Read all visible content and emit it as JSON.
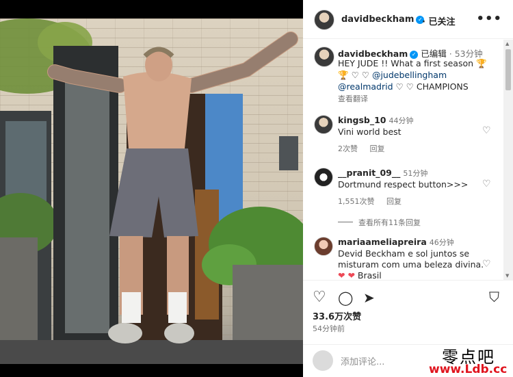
{
  "photo": {
    "alt": ""
  },
  "header": {
    "username": "davidbeckham",
    "follow_status": "已关注",
    "more": "•••"
  },
  "caption": {
    "username": "davidbeckham",
    "edited": "已编辑",
    "time": "53分钟",
    "line1": "HEY JUDE !! What a first season",
    "mention1": "@judebellingham",
    "mention2": "@realmadrid",
    "champions": "CHAMPIONS",
    "translate": "查看翻译"
  },
  "comments": [
    {
      "username": "kingsb_10",
      "time": "44分钟",
      "text": "Vini world best",
      "likes": "2次赞",
      "reply": "回复"
    },
    {
      "username": "__pranit_09__",
      "time": "51分钟",
      "text": "Dortmund respect button>>>",
      "likes": "1,551次赞",
      "reply": "回复",
      "view_replies": "查看所有11条回复"
    },
    {
      "username": "mariaameliapreira",
      "time": "46分钟",
      "text_line1": "Devid Beckham e sol juntos se",
      "text_line2": "misturam com uma beleza divina.",
      "text_line3": "Brasil"
    }
  ],
  "actions": {
    "likes": "33.6万次赞",
    "posted": "54分钟前"
  },
  "add_comment": {
    "placeholder": "添加评论..."
  },
  "watermark": {
    "line1": "零点吧",
    "line2": "www.Ldb.cc"
  },
  "colors": {
    "verified": "#0095f6",
    "heart": "#ed4956",
    "watermark": "#e0141e"
  }
}
